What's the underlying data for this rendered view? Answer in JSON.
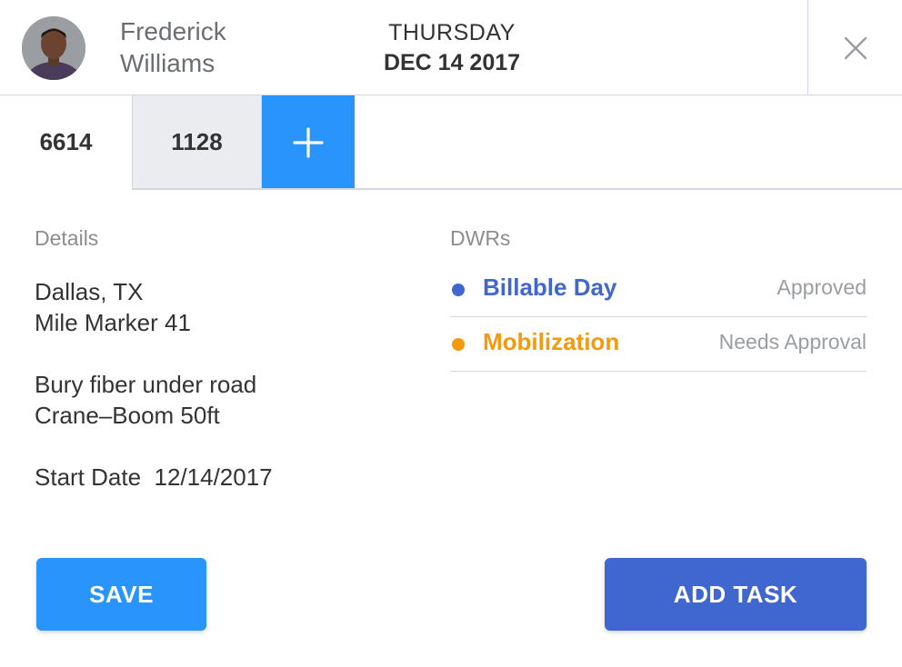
{
  "header": {
    "user_first": "Frederick",
    "user_last": "Williams",
    "day": "THURSDAY",
    "date": "DEC 14 2017"
  },
  "tabs": [
    {
      "label": "6614",
      "selected": true
    },
    {
      "label": "1128",
      "selected": false
    }
  ],
  "add_tab_icon": "plus-icon",
  "details": {
    "heading": "Details",
    "location_city": "Dallas, TX",
    "location_marker": "Mile Marker 41",
    "task": "Bury fiber under road",
    "equipment": "Crane–Boom 50ft",
    "start_date_label": "Start Date",
    "start_date": "12/14/2017"
  },
  "dwrs": {
    "heading": "DWRs",
    "items": [
      {
        "title": "Billable Day",
        "status": "Approved",
        "color": "#4066d0"
      },
      {
        "title": "Mobilization",
        "status": "Needs Approval",
        "color": "#f39a0f"
      }
    ]
  },
  "actions": {
    "save_label": "SAVE",
    "add_task_label": "ADD TASK"
  },
  "colors": {
    "primary_blue": "#2994fb",
    "indigo": "#4066d0",
    "orange": "#f39a0f"
  }
}
